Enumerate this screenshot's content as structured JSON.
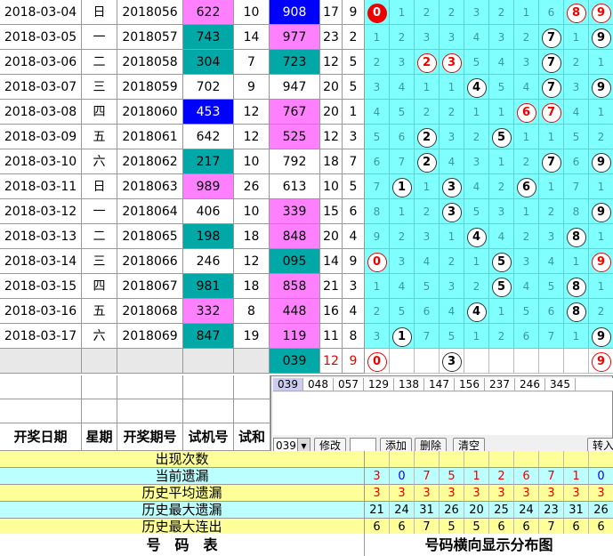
{
  "rows": [
    {
      "date": "2018-03-04",
      "weekday": "日",
      "issue": "2018056",
      "test": "622",
      "test_color": "pink",
      "test_sum": "10",
      "winning": "908",
      "win_color": "blue",
      "sum": "17",
      "span": "9"
    },
    {
      "date": "2018-03-05",
      "weekday": "一",
      "issue": "2018057",
      "test": "743",
      "test_color": "teal",
      "test_sum": "14",
      "winning": "977",
      "win_color": "pink",
      "sum": "23",
      "span": "2"
    },
    {
      "date": "2018-03-06",
      "weekday": "二",
      "issue": "2018058",
      "test": "304",
      "test_color": "teal",
      "test_sum": "7",
      "winning": "723",
      "win_color": "teal",
      "sum": "12",
      "span": "5"
    },
    {
      "date": "2018-03-07",
      "weekday": "三",
      "issue": "2018059",
      "test": "702",
      "test_color": "none",
      "test_sum": "9",
      "winning": "947",
      "win_color": "none",
      "sum": "20",
      "span": "5"
    },
    {
      "date": "2018-03-08",
      "weekday": "四",
      "issue": "2018060",
      "test": "453",
      "test_color": "blue",
      "test_sum": "12",
      "winning": "767",
      "win_color": "pink",
      "sum": "20",
      "span": "1"
    },
    {
      "date": "2018-03-09",
      "weekday": "五",
      "issue": "2018061",
      "test": "642",
      "test_color": "none",
      "test_sum": "12",
      "winning": "525",
      "win_color": "pink",
      "sum": "12",
      "span": "3"
    },
    {
      "date": "2018-03-10",
      "weekday": "六",
      "issue": "2018062",
      "test": "217",
      "test_color": "teal",
      "test_sum": "10",
      "winning": "792",
      "win_color": "none",
      "sum": "18",
      "span": "7"
    },
    {
      "date": "2018-03-11",
      "weekday": "日",
      "issue": "2018063",
      "test": "989",
      "test_color": "pink",
      "test_sum": "26",
      "winning": "613",
      "win_color": "none",
      "sum": "10",
      "span": "5"
    },
    {
      "date": "2018-03-12",
      "weekday": "一",
      "issue": "2018064",
      "test": "406",
      "test_color": "none",
      "test_sum": "10",
      "winning": "339",
      "win_color": "pink",
      "sum": "15",
      "span": "6"
    },
    {
      "date": "2018-03-13",
      "weekday": "二",
      "issue": "2018065",
      "test": "198",
      "test_color": "teal",
      "test_sum": "18",
      "winning": "848",
      "win_color": "pink",
      "sum": "20",
      "span": "4"
    },
    {
      "date": "2018-03-14",
      "weekday": "三",
      "issue": "2018066",
      "test": "246",
      "test_color": "none",
      "test_sum": "12",
      "winning": "095",
      "win_color": "teal",
      "sum": "14",
      "span": "9"
    },
    {
      "date": "2018-03-15",
      "weekday": "四",
      "issue": "2018067",
      "test": "981",
      "test_color": "teal",
      "test_sum": "18",
      "winning": "858",
      "win_color": "pink",
      "sum": "21",
      "span": "3"
    },
    {
      "date": "2018-03-16",
      "weekday": "五",
      "issue": "2018068",
      "test": "332",
      "test_color": "pink",
      "test_sum": "8",
      "winning": "448",
      "win_color": "pink",
      "sum": "16",
      "span": "4"
    },
    {
      "date": "2018-03-17",
      "weekday": "六",
      "issue": "2018069",
      "test": "847",
      "test_color": "teal",
      "test_sum": "19",
      "winning": "119",
      "win_color": "pink",
      "sum": "11",
      "span": "8"
    }
  ],
  "grid": [
    [
      {
        "v": "0",
        "m": "fill"
      },
      {
        "v": "1"
      },
      {
        "v": "2"
      },
      {
        "v": "2"
      },
      {
        "v": "3"
      },
      {
        "v": "2"
      },
      {
        "v": "1"
      },
      {
        "v": "6"
      },
      {
        "v": "8",
        "m": "red"
      },
      {
        "v": "9",
        "m": "red"
      }
    ],
    [
      {
        "v": "1"
      },
      {
        "v": "2"
      },
      {
        "v": "3"
      },
      {
        "v": "3"
      },
      {
        "v": "4"
      },
      {
        "v": "3"
      },
      {
        "v": "2"
      },
      {
        "v": "7",
        "m": "black"
      },
      {
        "v": "1"
      },
      {
        "v": "9",
        "m": "black"
      }
    ],
    [
      {
        "v": "2"
      },
      {
        "v": "3"
      },
      {
        "v": "2",
        "m": "red"
      },
      {
        "v": "3",
        "m": "red"
      },
      {
        "v": "5"
      },
      {
        "v": "4"
      },
      {
        "v": "3"
      },
      {
        "v": "7",
        "m": "black"
      },
      {
        "v": "2"
      },
      {
        "v": "1"
      }
    ],
    [
      {
        "v": "3"
      },
      {
        "v": "4"
      },
      {
        "v": "1"
      },
      {
        "v": "1"
      },
      {
        "v": "4",
        "m": "black"
      },
      {
        "v": "5"
      },
      {
        "v": "4"
      },
      {
        "v": "7",
        "m": "black"
      },
      {
        "v": "3"
      },
      {
        "v": "9",
        "m": "black"
      }
    ],
    [
      {
        "v": "4"
      },
      {
        "v": "5"
      },
      {
        "v": "2"
      },
      {
        "v": "2"
      },
      {
        "v": "1"
      },
      {
        "v": "1"
      },
      {
        "v": "6",
        "m": "red"
      },
      {
        "v": "7",
        "m": "red"
      },
      {
        "v": "4"
      },
      {
        "v": "1"
      }
    ],
    [
      {
        "v": "5"
      },
      {
        "v": "6"
      },
      {
        "v": "2",
        "m": "black"
      },
      {
        "v": "3"
      },
      {
        "v": "2"
      },
      {
        "v": "5",
        "m": "black"
      },
      {
        "v": "1"
      },
      {
        "v": "1"
      },
      {
        "v": "5"
      },
      {
        "v": "2"
      }
    ],
    [
      {
        "v": "6"
      },
      {
        "v": "7"
      },
      {
        "v": "2",
        "m": "black"
      },
      {
        "v": "4"
      },
      {
        "v": "3"
      },
      {
        "v": "1"
      },
      {
        "v": "2"
      },
      {
        "v": "7",
        "m": "black"
      },
      {
        "v": "6"
      },
      {
        "v": "9",
        "m": "black"
      }
    ],
    [
      {
        "v": "7"
      },
      {
        "v": "1",
        "m": "black"
      },
      {
        "v": "1"
      },
      {
        "v": "3",
        "m": "black"
      },
      {
        "v": "4"
      },
      {
        "v": "2"
      },
      {
        "v": "6",
        "m": "black"
      },
      {
        "v": "1"
      },
      {
        "v": "7"
      },
      {
        "v": "1"
      }
    ],
    [
      {
        "v": "8"
      },
      {
        "v": "1"
      },
      {
        "v": "2"
      },
      {
        "v": "3",
        "m": "black"
      },
      {
        "v": "5"
      },
      {
        "v": "3"
      },
      {
        "v": "1"
      },
      {
        "v": "2"
      },
      {
        "v": "8"
      },
      {
        "v": "9",
        "m": "black"
      }
    ],
    [
      {
        "v": "9"
      },
      {
        "v": "2"
      },
      {
        "v": "3"
      },
      {
        "v": "1"
      },
      {
        "v": "4",
        "m": "black"
      },
      {
        "v": "4"
      },
      {
        "v": "2"
      },
      {
        "v": "3"
      },
      {
        "v": "8",
        "m": "black"
      },
      {
        "v": "1"
      }
    ],
    [
      {
        "v": "0",
        "m": "red"
      },
      {
        "v": "3"
      },
      {
        "v": "4"
      },
      {
        "v": "2"
      },
      {
        "v": "1"
      },
      {
        "v": "5",
        "m": "black"
      },
      {
        "v": "3"
      },
      {
        "v": "4"
      },
      {
        "v": "1"
      },
      {
        "v": "9",
        "m": "red"
      }
    ],
    [
      {
        "v": "1"
      },
      {
        "v": "4"
      },
      {
        "v": "5"
      },
      {
        "v": "3"
      },
      {
        "v": "2"
      },
      {
        "v": "5",
        "m": "black"
      },
      {
        "v": "4"
      },
      {
        "v": "5"
      },
      {
        "v": "8",
        "m": "black"
      },
      {
        "v": "1"
      }
    ],
    [
      {
        "v": "2"
      },
      {
        "v": "5"
      },
      {
        "v": "6"
      },
      {
        "v": "4"
      },
      {
        "v": "4",
        "m": "black"
      },
      {
        "v": "1"
      },
      {
        "v": "5"
      },
      {
        "v": "6"
      },
      {
        "v": "8",
        "m": "black"
      },
      {
        "v": "2"
      }
    ],
    [
      {
        "v": "3"
      },
      {
        "v": "1",
        "m": "black"
      },
      {
        "v": "7"
      },
      {
        "v": "5"
      },
      {
        "v": "1"
      },
      {
        "v": "2"
      },
      {
        "v": "6"
      },
      {
        "v": "7"
      },
      {
        "v": "1"
      },
      {
        "v": "9",
        "m": "black"
      }
    ]
  ],
  "pending": {
    "winning": "039",
    "sum": "12",
    "span": "9",
    "marks": [
      {
        "col": 0,
        "v": "0",
        "m": "red"
      },
      {
        "col": 3,
        "v": "3",
        "m": "black"
      },
      {
        "col": 9,
        "v": "9",
        "m": "red"
      }
    ]
  },
  "headers": {
    "date": "开奖日期",
    "weekday": "星期",
    "issue": "开奖期号",
    "test": "试机号",
    "test_sum": "试和"
  },
  "panel": {
    "tabs": [
      "039",
      "048",
      "057",
      "129",
      "138",
      "147",
      "156",
      "237",
      "246",
      "345"
    ],
    "select_value": "039",
    "modify": "修改",
    "add": "添加",
    "delete": "删除",
    "clear": "清空",
    "import": "转入"
  },
  "stats": [
    {
      "label": "出现次数",
      "values": [
        "",
        "",
        "",
        "",
        "",
        "",
        "",
        "",
        "",
        ""
      ]
    },
    {
      "label": "当前遗漏",
      "values": [
        "3",
        "0",
        "7",
        "5",
        "1",
        "2",
        "6",
        "7",
        "1",
        "0"
      ]
    },
    {
      "label": "历史平均遗漏",
      "values": [
        "3",
        "3",
        "3",
        "3",
        "3",
        "3",
        "3",
        "3",
        "3",
        "3"
      ]
    },
    {
      "label": "历史最大遗漏",
      "values": [
        "21",
        "24",
        "31",
        "26",
        "20",
        "25",
        "24",
        "23",
        "31",
        "26"
      ]
    },
    {
      "label": "历史最大连出",
      "values": [
        "6",
        "6",
        "7",
        "5",
        "5",
        "6",
        "6",
        "7",
        "6",
        "6"
      ]
    }
  ],
  "footer": {
    "left": "号　码　表",
    "right": "号码横向显示分布图"
  }
}
